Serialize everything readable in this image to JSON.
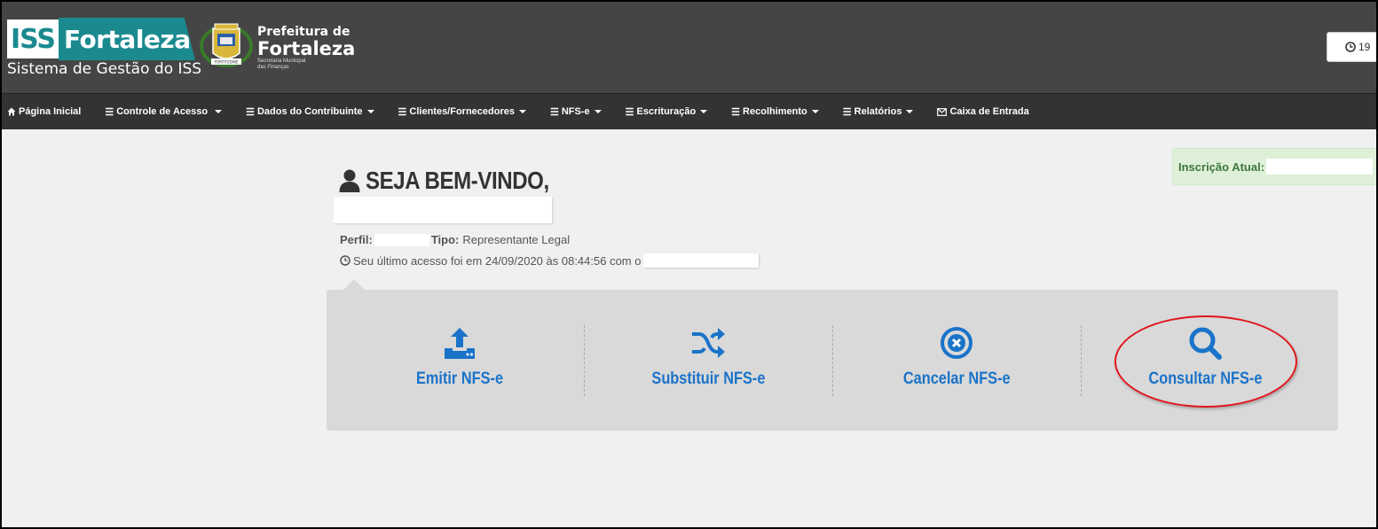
{
  "header": {
    "logo_iss": "ISS",
    "logo_name": "Fortaleza",
    "logo_subtitle": "Sistema de Gestão do ISS",
    "crest_banner": "FORTITUDINE",
    "prefeitura_line1": "Prefeitura de",
    "prefeitura_line2": "Fortaleza",
    "prefeitura_line3": "Secretaria Municipal",
    "prefeitura_line4": "das Finanças",
    "clock_text": "19"
  },
  "nav": {
    "items": [
      {
        "label": "Página Inicial",
        "icon": "home-icon",
        "dropdown": false
      },
      {
        "label": "Controle de Acesso",
        "icon": "list-icon",
        "dropdown": true
      },
      {
        "label": "Dados do Contribuinte",
        "icon": "list-icon",
        "dropdown": true
      },
      {
        "label": "Clientes/Fornecedores",
        "icon": "list-icon",
        "dropdown": true
      },
      {
        "label": "NFS-e",
        "icon": "list-icon",
        "dropdown": true
      },
      {
        "label": "Escrituração",
        "icon": "list-icon",
        "dropdown": true
      },
      {
        "label": "Recolhimento",
        "icon": "list-icon",
        "dropdown": true
      },
      {
        "label": "Relatórios",
        "icon": "list-icon",
        "dropdown": true
      },
      {
        "label": "Caixa de Entrada",
        "icon": "envelope-icon",
        "dropdown": false
      }
    ]
  },
  "inscricao": {
    "label": "Inscrição Atual:"
  },
  "welcome": {
    "title": "SEJA BEM-VINDO,",
    "perfil_label": "Perfil:",
    "tipo_label": "Tipo:",
    "tipo_value": "Representante Legal",
    "last_access": "Seu último acesso foi em 24/09/2020 às 08:44:56 com o"
  },
  "actions": [
    {
      "label": "Emitir NFS-e",
      "icon": "upload-icon"
    },
    {
      "label": "Substituir NFS-e",
      "icon": "shuffle-icon"
    },
    {
      "label": "Cancelar NFS-e",
      "icon": "cancel-circle-icon"
    },
    {
      "label": "Consultar NFS-e",
      "icon": "search-icon"
    }
  ],
  "colors": {
    "header_bg": "#454545",
    "nav_bg": "#333333",
    "brand_teal": "#1b8a8f",
    "action_blue": "#1a73c9",
    "highlight_red": "#e0161b",
    "alert_green": "#3c763d"
  }
}
